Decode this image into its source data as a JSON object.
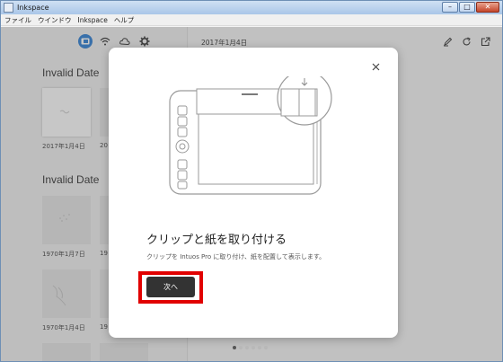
{
  "window": {
    "title": "Inkspace",
    "minimize": "–",
    "maximize": "□",
    "close": "✕"
  },
  "menu": [
    "ファイル",
    "ウインドウ",
    "Inkspace",
    "ヘルプ"
  ],
  "sidebar": {
    "icons": [
      "tablet-icon",
      "wifi-icon",
      "cloud-icon",
      "gear-icon"
    ],
    "groups": [
      {
        "title": "Invalid Date",
        "items": [
          {
            "date": "2017年1月4日"
          },
          {
            "date": "20"
          }
        ]
      },
      {
        "title": "Invalid Date",
        "items": [
          {
            "date": "1970年1月7日"
          },
          {
            "date": "19"
          },
          {
            "date": "1970年1月4日"
          },
          {
            "date": "19"
          }
        ]
      }
    ]
  },
  "main": {
    "date": "2017年1月4日",
    "icons": [
      "pen-icon",
      "refresh-icon",
      "share-icon"
    ]
  },
  "dialog": {
    "title": "クリップと紙を取り付ける",
    "description": "クリップを Intuos Pro に取り付け、紙を配置して表示します。",
    "next_label": "次へ"
  },
  "pager": {
    "total": 6,
    "active": 0
  }
}
